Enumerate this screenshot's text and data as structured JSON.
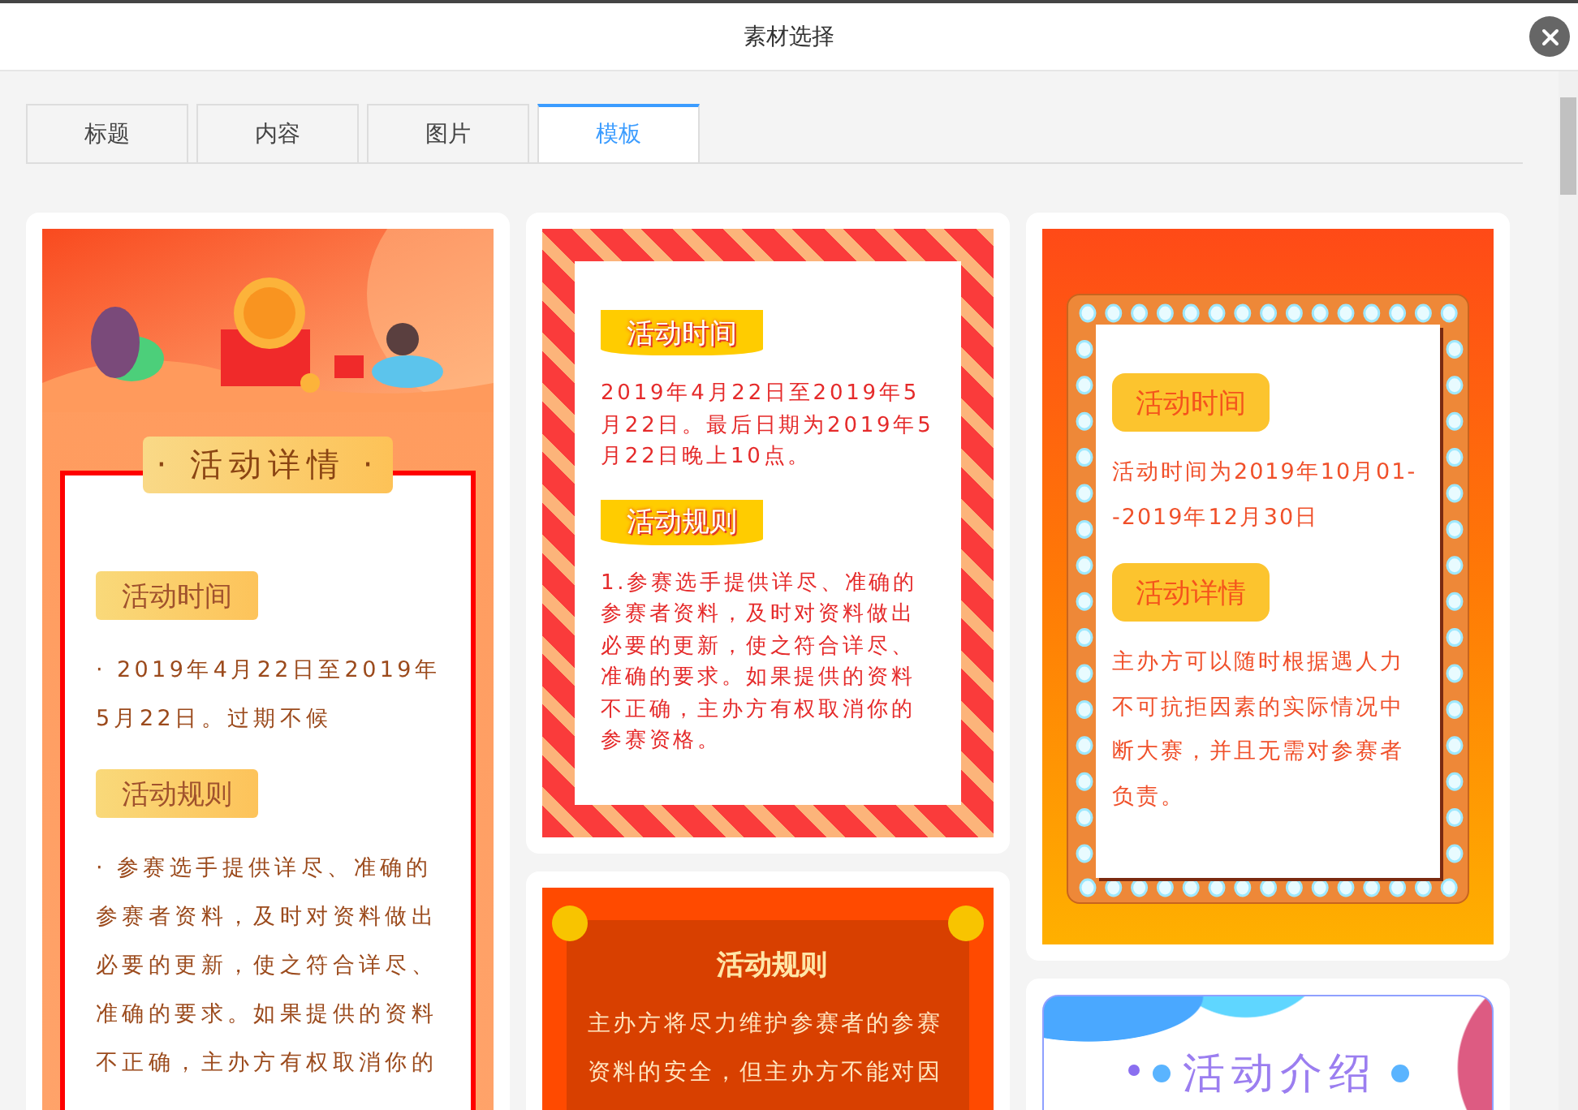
{
  "dialog": {
    "title": "素材选择"
  },
  "tabs": [
    {
      "label": "标题",
      "selected": false
    },
    {
      "label": "内容",
      "selected": false
    },
    {
      "label": "图片",
      "selected": false
    },
    {
      "label": "模板",
      "selected": true
    }
  ],
  "columns": [
    {
      "templates": [
        {
          "kind": "banner",
          "heading": "· 活动详情 ·",
          "sections": [
            {
              "tag": "活动时间",
              "text": "· 2019年4月22日至2019年5月22日。过期不候"
            },
            {
              "tag": "活动规则",
              "text": "· 参赛选手提供详尽、准确的参赛者资料，及时对资料做出必要的更新，使之符合详尽、准确的要求。如果提供的资料不正确，主办方有权取消你的"
            }
          ]
        }
      ]
    },
    {
      "templates": [
        {
          "kind": "stripes",
          "sections": [
            {
              "tag": "活动时间",
              "text": "2019年4月22日至2019年5月22日。最后日期为2019年5月22日晚上10点。"
            },
            {
              "tag": "活动规则",
              "text": "1.参赛选手提供详尽、准确的参赛者资料，及时对资料做出必要的更新，使之符合详尽、准确的要求。如果提供的资料不正确，主办方有权取消你的参赛资格。"
            }
          ]
        },
        {
          "kind": "notice",
          "heading": "活动规则",
          "text": "主办方将尽力维护参赛者的参赛资料的安全，但主办方不能对因"
        }
      ]
    },
    {
      "templates": [
        {
          "kind": "marquee",
          "sections": [
            {
              "tag": "活动时间",
              "text": "活动时间为2019年10月01--2019年12月30日"
            },
            {
              "tag": "活动详情",
              "text": "主办方可以随时根据遇人力不可抗拒因素的实际情况中断大赛，并且无需对参赛者负责。"
            }
          ]
        },
        {
          "kind": "intro",
          "heading": "活动介绍"
        }
      ]
    }
  ]
}
